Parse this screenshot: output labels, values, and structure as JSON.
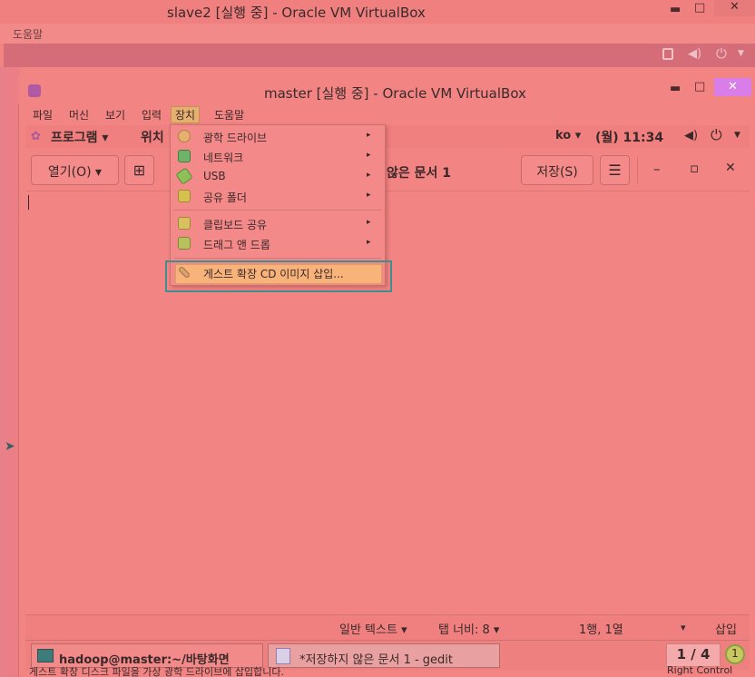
{
  "outer_window": {
    "title": "slave2 [실행 중] - Oracle VM VirtualBox",
    "menu_help": "도움말",
    "controls": {
      "minimize": "▬",
      "maximize": "□",
      "close": "✕"
    }
  },
  "inner_window": {
    "title": "master [실행 중] - Oracle VM VirtualBox",
    "controls": {
      "minimize": "▬",
      "maximize": "□",
      "close": "✕"
    },
    "menubar": [
      "파일",
      "머신",
      "보기",
      "입력",
      "장치",
      "도움말"
    ],
    "active_menu": "장치"
  },
  "gnome_bar": {
    "programs": "프로그램 ▾",
    "places": "위치",
    "lang": "ko ▾",
    "clock": "(월) 11:34"
  },
  "gedit": {
    "open_button": "열기(O) ▾",
    "new_tab_icon": "⊞",
    "doc_title": "않은 문서 1",
    "save_button": "저장(S)",
    "menu_icon": "☰",
    "win_min": "–",
    "win_max": "▫",
    "win_close": "✕"
  },
  "device_menu": {
    "items": [
      {
        "label": "광학 드라이브",
        "icon": "disc-icon",
        "color": "#e5b070",
        "submenu": true
      },
      {
        "label": "네트워크",
        "icon": "network-icon",
        "color": "#6fb26a",
        "submenu": true
      },
      {
        "label": "USB",
        "icon": "usb-icon",
        "color": "#8dbf5a",
        "submenu": true
      },
      {
        "label": "공유 폴더",
        "icon": "folder-icon",
        "color": "#d6c050",
        "submenu": true
      },
      {
        "label": "클립보드 공유",
        "icon": "clipboard-icon",
        "color": "#d8c060",
        "submenu": true
      },
      {
        "label": "드래그 앤 드롭",
        "icon": "drag-drop-icon",
        "color": "#b9c060",
        "submenu": true
      },
      {
        "label": "게스트 확장 CD 이미지 삽입...",
        "icon": "cd-insert-icon",
        "color": "#d9a070",
        "submenu": false
      }
    ],
    "submenu_arrow": "▸"
  },
  "statusbar": {
    "syntax": "일반 텍스트 ▾",
    "tab_width": "탭 너비: 8 ▾",
    "position": "1행, 1열",
    "dropdown": "▾",
    "insert_mode": "삽입"
  },
  "taskbar": {
    "terminal_task": "hadoop@master:~/바탕화면",
    "gedit_task": "*저장하지 않은 문서 1 - gedit",
    "workspace": "1 / 4",
    "notifications": "1"
  },
  "bottom_status": {
    "message": "게스트 확장 디스크 파일을 가상 광학 드라이브에 삽입합니다.",
    "host_key": "Right Control"
  }
}
